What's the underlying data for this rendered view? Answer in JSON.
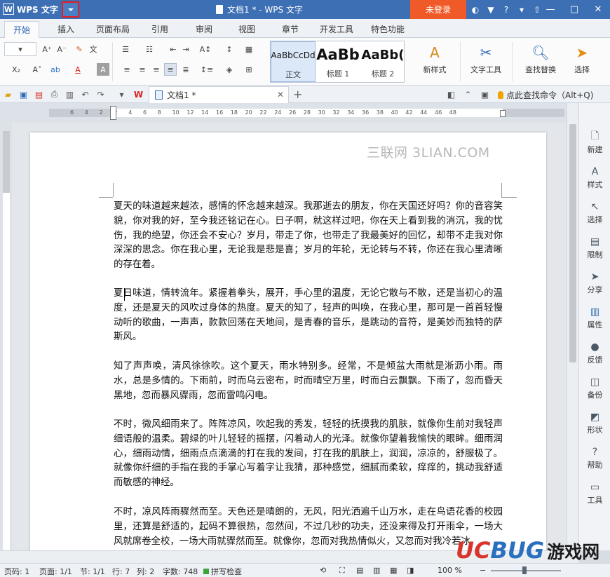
{
  "app": {
    "name": "WPS 文字",
    "logo_letter": "W"
  },
  "window": {
    "title": "文档1 * - WPS 文字",
    "login_label": "未登录",
    "help_label": "?"
  },
  "tabs": [
    "开始",
    "插入",
    "页面布局",
    "引用",
    "审阅",
    "视图",
    "章节",
    "开发工具",
    "特色功能"
  ],
  "active_tab": "开始",
  "ribbon": {
    "styles": [
      {
        "sample": "AaBbCcDd",
        "name": "正文"
      },
      {
        "sample": "AaBb",
        "name": "标题 1"
      },
      {
        "sample": "AaBb(",
        "name": "标题 2"
      }
    ],
    "new_style": "新样式",
    "text_tools": "文字工具",
    "find_replace": "查找替换",
    "select": "选择"
  },
  "doc_tab": {
    "title": "文档1 *"
  },
  "find_command": "点此查找命令（Alt+Q)",
  "ruler_numbers": [
    "6",
    "4",
    "2",
    "2",
    "4",
    "6",
    "8",
    "10",
    "12",
    "14",
    "16",
    "18",
    "20",
    "22",
    "24",
    "26",
    "28",
    "30",
    "32",
    "34",
    "36",
    "38",
    "40",
    "42",
    "44",
    "46",
    "48"
  ],
  "document": {
    "watermark": "三联网 3LIAN.COM",
    "paragraphs": [
      "夏天的味道越来越浓，感情的怀念越来越深。我那逝去的朋友，你在天国还好吗？你的音容笑貌，你对我的好，至今我还铭记在心。日子啊，就这样过吧，你在天上看到我的消沉，我的忧伤，我的绝望，你还会不安心？岁月，带走了你，也带走了我最美好的回忆，却带不走我对你深深的思念。你在我心里，无论我是悲是喜；岁月的年轮，无论转与不转，你还在我心里清晰的存在着。",
      "夏日味道，情转流年。紧握着拳头，展开，手心里的温度，无论它散与不散，还是当初心的温度，还是夏天的风吹过身体的热度。夏天的知了，轻声的叫唤，在我心里，那可是一首首轻慢动听的歌曲，一声声，款款回荡在天地间，是青春的音乐，是跳动的音符，是美妙而独特的萨斯风。",
      "知了声声唤，清风徐徐吹。这个夏天，雨水特别多。经常，不是倾盆大雨就是淅沥小雨。雨水，总是多情的。下雨前，时而乌云密布，时而晴空万里，时而白云飘飘。下雨了，忽而昏天黑地，忽而暴风骤雨，忽而雷鸣闪电。",
      "不时，微风细雨来了。阵阵凉风，吹起我的秀发，轻轻的抚摸我的肌肤，就像你生前对我轻声细语般的温柔。碧绿的叶儿轻轻的摇摆，闪着动人的光泽。就像你望着我愉快的眼眸。细雨润心，细雨动情，细雨点点滴滴的打在我的发间，打在我的肌肤上，润润，凉凉的，舒服极了。就像你纤细的手指在我的手掌心写着字让我猜，那种感觉，细腻而柔软，痒痒的，挑动我舒适而敏感的神经。",
      "不时，凉风阵雨骤然而至。天色还是晴朗的，无风，阳光洒遍千山万水，走在鸟语花香的校园里，还算是舒适的，起码不算很热，忽然间，不过几秒的功夫，还没来得及打开雨伞，一场大风就席卷全校，一场大雨就骤然而至。就像你，忽而对我热情似火，又忽而对我冷若冰"
    ]
  },
  "right_panel": [
    "新建",
    "样式",
    "选择",
    "限制",
    "分享",
    "属性",
    "反馈",
    "备份",
    "形状",
    "帮助",
    "工具"
  ],
  "status": {
    "page_code": "页码: 1",
    "pages": "页面: 1/1",
    "section": "节: 1/1",
    "row": "行: 7",
    "col": "列: 2",
    "word_count": "字数: 748",
    "spell_check": "拼写检查",
    "zoom": "100 %"
  },
  "branding": {
    "u": "UC",
    "b": "BUG",
    "cn": "游戏网"
  }
}
